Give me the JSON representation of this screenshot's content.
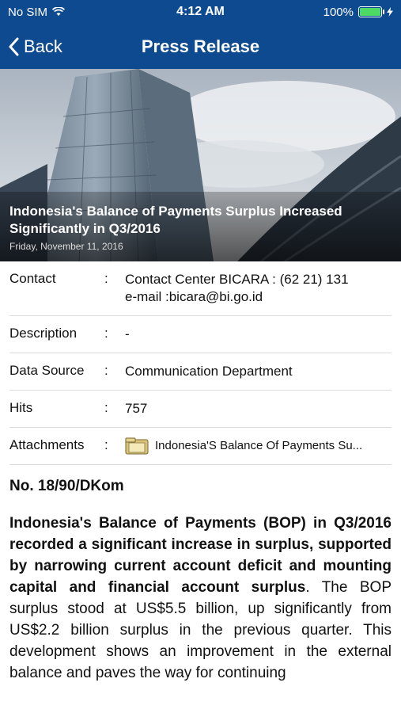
{
  "status_bar": {
    "carrier": "No SIM",
    "time": "4:12 AM",
    "battery": "100%"
  },
  "nav": {
    "back_label": "Back",
    "title": "Press Release"
  },
  "hero": {
    "title": "Indonesia's Balance of Payments Surplus Increased Significantly in Q3/2016",
    "date": "Friday, November 11, 2016"
  },
  "info": {
    "contact": {
      "label": "Contact",
      "colon": ":",
      "value_line1": "Contact Center BICARA : (62 21) 131",
      "value_line2": "e-mail :bicara@bi.go.id"
    },
    "description": {
      "label": "Description",
      "colon": ":",
      "value": "-"
    },
    "data_source": {
      "label": "Data Source",
      "colon": ":",
      "value": "Communication Department"
    },
    "hits": {
      "label": "Hits",
      "colon": ":",
      "value": "757"
    },
    "attachments": {
      "label": "Attachments",
      "colon": ":",
      "file_name": "Indonesia'S Balance Of Payments Su..."
    }
  },
  "article": {
    "ref_no": "No. 18/90/DKom",
    "bold_lead": "Indonesia's Balance of Payments (BOP) in Q3/2016 recorded a significant increase in surplus, supported by narrowing current account deficit and mounting capital and financial account surplus",
    "body_rest": ". The BOP surplus stood at US$5.5 billion, up significantly from US$2.2 billion surplus in the previous quarter. This development shows an improvement in the external balance and paves the way for continuing"
  }
}
